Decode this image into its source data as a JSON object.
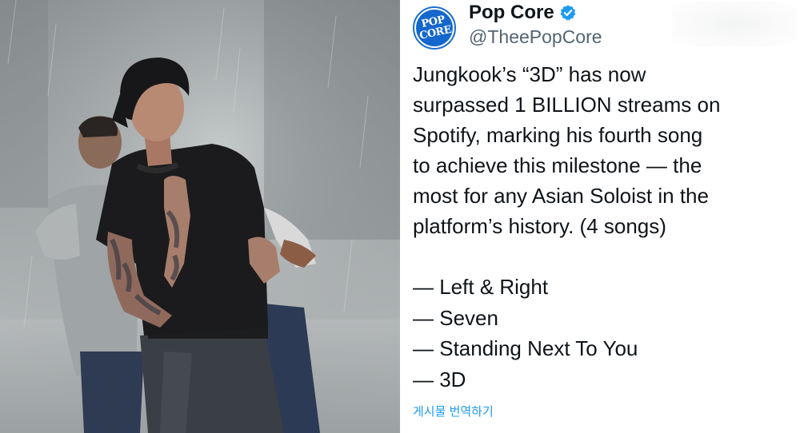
{
  "colors": {
    "brand_blue": "#1467cc",
    "verified_blue": "#1d9bf0",
    "text_primary": "#0f1419",
    "text_secondary": "#536471",
    "link_blue": "#1d9bf0"
  },
  "tweet": {
    "avatar": {
      "line1": "POP",
      "line2": "CORE"
    },
    "display_name": "Pop Core",
    "verified_icon": "verified-badge-icon",
    "handle": "@ThеePopCore",
    "text_lines": [
      "Jungkook’s “3D” has now",
      "surpassed 1 BILLION streams on",
      "Spotify, marking his fourth song",
      "to achieve this milestone — the",
      "most for any Asian Soloist in the",
      "platform’s history. (4 songs)"
    ],
    "songs": [
      "— Left & Right",
      "— Seven",
      "— Standing Next To You",
      "— 3D"
    ],
    "translate_label": "게시물 번역하기"
  }
}
